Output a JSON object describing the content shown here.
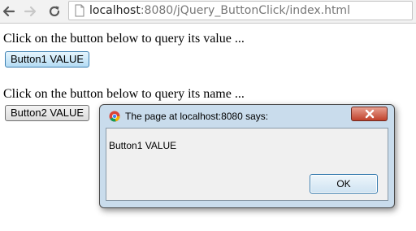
{
  "browser": {
    "url_host": "localhost",
    "url_path": ":8080/jQuery_ButtonClick/index.html",
    "icons": {
      "back": "back-arrow-icon",
      "forward": "forward-arrow-icon",
      "reload": "reload-icon",
      "page": "page-icon"
    }
  },
  "page": {
    "prompt_value": "Click on the button below to query its value ...",
    "button1_label": "Button1 VALUE",
    "prompt_name": "Click on the button below to query its name ...",
    "button2_label": "Button2 VALUE"
  },
  "dialog": {
    "title": "The page at localhost:8080 says:",
    "message": "Button1 VALUE",
    "ok_label": "OK"
  },
  "colors": {
    "dialog_frame": "#c9dcec",
    "close_button": "#c0412b",
    "active_button": "#b4dcf4"
  }
}
